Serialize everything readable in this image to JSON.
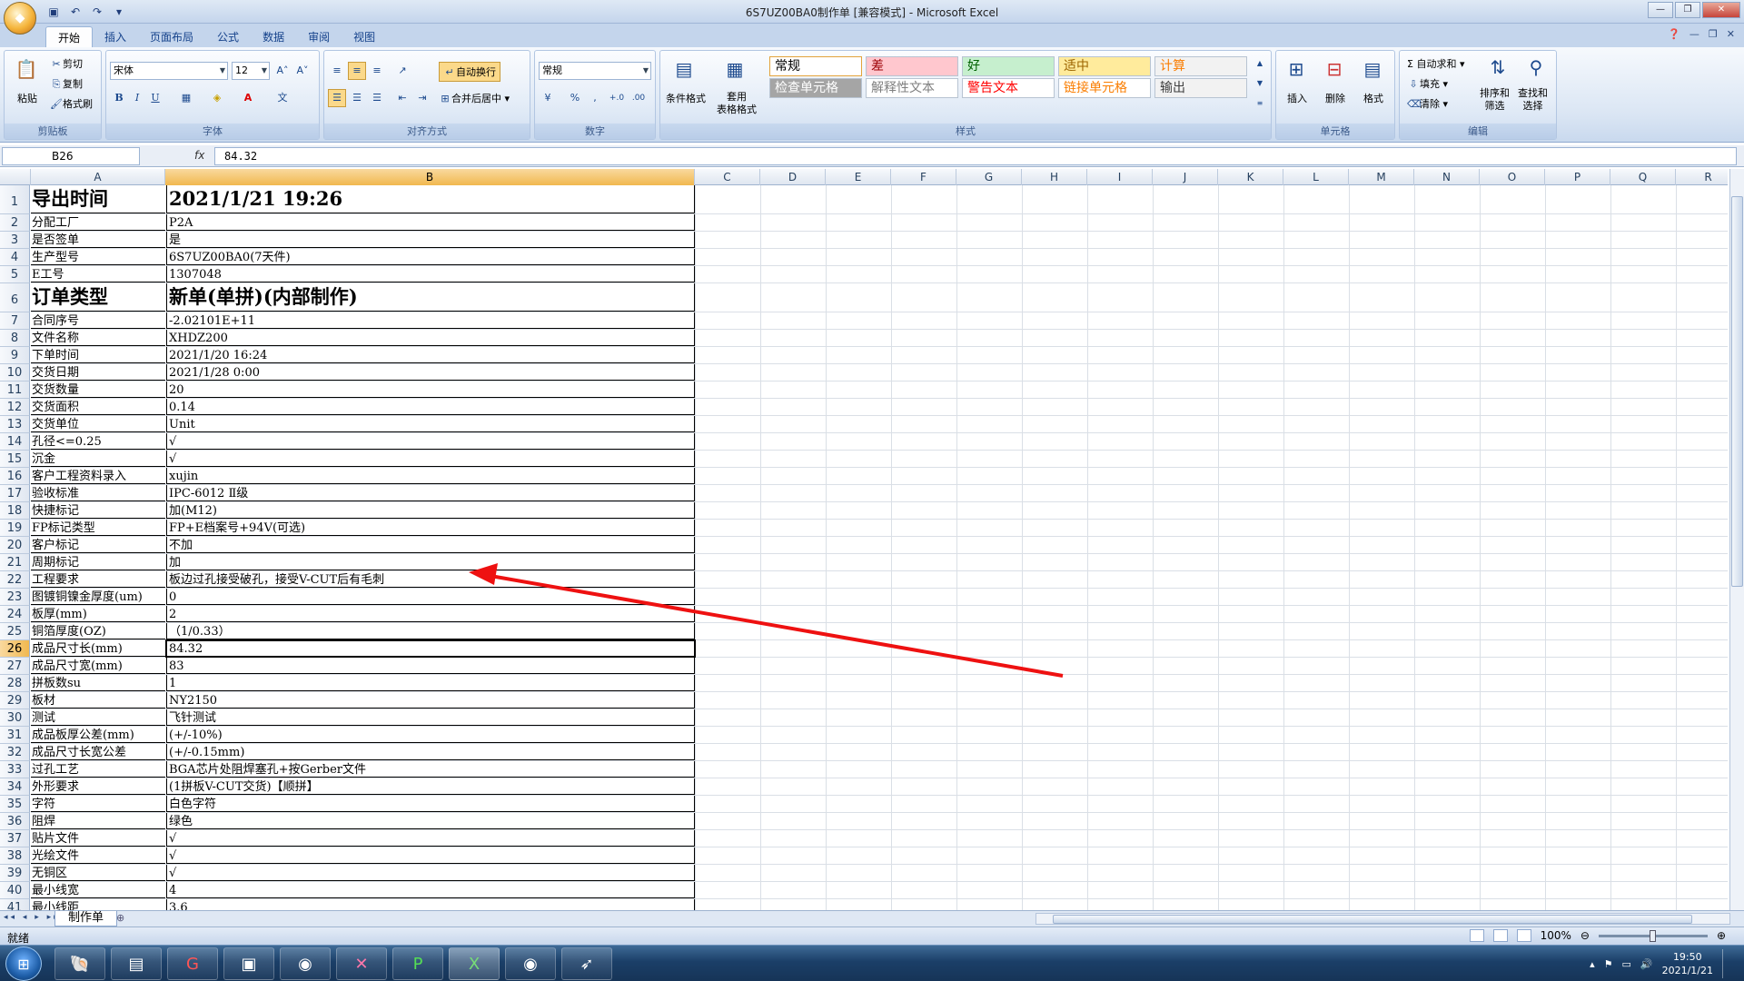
{
  "window": {
    "title": "6S7UZ00BA0制作单 [兼容模式] - Microsoft Excel",
    "office_logo": "office-logo"
  },
  "qat": [
    "save-icon",
    "undo-icon",
    "redo-icon",
    "customize-icon"
  ],
  "tabs": [
    "开始",
    "插入",
    "页面布局",
    "公式",
    "数据",
    "审阅",
    "视图"
  ],
  "ribbon": {
    "clipboard": {
      "label": "剪贴板",
      "paste": "粘贴",
      "cut": "剪切",
      "copy": "复制",
      "format_painter": "格式刷"
    },
    "font": {
      "label": "字体",
      "name": "宋体",
      "size": "12",
      "bold": "B",
      "italic": "I",
      "underline": "U",
      "grow": "A˄",
      "shrink": "A˅",
      "font_color_glyph": "A"
    },
    "alignment": {
      "label": "对齐方式",
      "wrap": "自动换行",
      "merge": "合并后居中"
    },
    "number": {
      "label": "数字",
      "format": "常规",
      "percent": "%",
      "comma": ",",
      "inc": "+.0",
      "dec": ".00"
    },
    "styles": {
      "label": "样式",
      "conditional": "条件格式",
      "table": "套用\n表格格式",
      "cells": [
        {
          "text": "常规",
          "color": "#000000",
          "bg": "#ffffff"
        },
        {
          "text": "差",
          "color": "#9c0006",
          "bg": "#ffc7ce"
        },
        {
          "text": "好",
          "color": "#006100",
          "bg": "#c6efce"
        },
        {
          "text": "适中",
          "color": "#9c6500",
          "bg": "#ffeb9c"
        },
        {
          "text": "计算",
          "color": "#fa7d00",
          "bg": "#f2f2f2"
        },
        {
          "text": "检查单元格",
          "color": "#ffffff",
          "bg": "#a5a5a5"
        },
        {
          "text": "解释性文本",
          "color": "#7f7f7f",
          "bg": "#ffffff"
        },
        {
          "text": "警告文本",
          "color": "#ff0000",
          "bg": "#ffffff"
        },
        {
          "text": "链接单元格",
          "color": "#fa7d00",
          "bg": "#ffffff"
        },
        {
          "text": "输出",
          "color": "#3f3f3f",
          "bg": "#f2f2f2"
        }
      ]
    },
    "cells": {
      "label": "单元格",
      "insert": "插入",
      "delete": "删除",
      "format": "格式"
    },
    "editing": {
      "label": "编辑",
      "autosum": "Σ 自动求和",
      "fill": "填充",
      "clear": "清除",
      "sort": "排序和\n筛选",
      "find": "查找和\n选择"
    }
  },
  "formula_bar": {
    "name_box": "B26",
    "fx": "fx",
    "content": "84.32"
  },
  "columns": [
    "A",
    "B",
    "C",
    "D",
    "E",
    "F",
    "G",
    "H",
    "I",
    "J",
    "K",
    "L",
    "M",
    "N",
    "O",
    "P",
    "Q",
    "R"
  ],
  "rows": [
    {
      "n": "1",
      "a": "导出时间",
      "b": "2021/1/21  19:26",
      "big": true
    },
    {
      "n": "2",
      "a": "分配工厂",
      "b": "P2A"
    },
    {
      "n": "3",
      "a": "是否签单",
      "b": "是"
    },
    {
      "n": "4",
      "a": "生产型号",
      "b": "6S7UZ00BA0(7天件)"
    },
    {
      "n": "5",
      "a": "E工号",
      "b": "1307048"
    },
    {
      "n": "6",
      "a": "订单类型",
      "b": "新单(单拼)(内部制作)",
      "big": true
    },
    {
      "n": "7",
      "a": "合同序号",
      "b": "-2.02101E+11"
    },
    {
      "n": "8",
      "a": "文件名称",
      "b": "XHDZ200"
    },
    {
      "n": "9",
      "a": "下单时间",
      "b": "2021/1/20 16:24"
    },
    {
      "n": "10",
      "a": "交货日期",
      "b": "2021/1/28 0:00"
    },
    {
      "n": "11",
      "a": "交货数量",
      "b": "20"
    },
    {
      "n": "12",
      "a": "交货面积",
      "b": "0.14"
    },
    {
      "n": "13",
      "a": "交货单位",
      "b": "Unit"
    },
    {
      "n": "14",
      "a": "孔径<=0.25",
      "b": "√"
    },
    {
      "n": "15",
      "a": "沉金",
      "b": "√"
    },
    {
      "n": "16",
      "a": "客户工程资料录入",
      "b": "xujin"
    },
    {
      "n": "17",
      "a": "验收标准",
      "b": "IPC-6012 Ⅱ级"
    },
    {
      "n": "18",
      "a": "快捷标记",
      "b": "加(M12)"
    },
    {
      "n": "19",
      "a": "FP标记类型",
      "b": "FP+E档案号+94V(可选)"
    },
    {
      "n": "20",
      "a": "客户标记",
      "b": "不加"
    },
    {
      "n": "21",
      "a": "周期标记",
      "b": "加"
    },
    {
      "n": "22",
      "a": "工程要求",
      "b": "板边过孔接受破孔，接受V-CUT后有毛刺"
    },
    {
      "n": "23",
      "a": "图镀铜镍金厚度(um)",
      "b": "0"
    },
    {
      "n": "24",
      "a": "板厚(mm)",
      "b": "2"
    },
    {
      "n": "25",
      "a": "铜箔厚度(OZ)",
      "b": "（1/0.33）"
    },
    {
      "n": "26",
      "a": "成品尺寸长(mm)",
      "b": "84.32",
      "active": true
    },
    {
      "n": "27",
      "a": "成品尺寸宽(mm)",
      "b": "83"
    },
    {
      "n": "28",
      "a": "拼板数su",
      "b": "1"
    },
    {
      "n": "29",
      "a": "板材",
      "b": "NY2150"
    },
    {
      "n": "30",
      "a": "测试",
      "b": "飞针测试"
    },
    {
      "n": "31",
      "a": "成品板厚公差(mm)",
      "b": "(+/-10%)"
    },
    {
      "n": "32",
      "a": "成品尺寸长宽公差",
      "b": "(+/-0.15mm)"
    },
    {
      "n": "33",
      "a": "过孔工艺",
      "b": "BGA芯片处阻焊塞孔+按Gerber文件"
    },
    {
      "n": "34",
      "a": "外形要求",
      "b": "(1拼板V-CUT交货)【顺拼】"
    },
    {
      "n": "35",
      "a": "字符",
      "b": "白色字符"
    },
    {
      "n": "36",
      "a": "阻焊",
      "b": "绿色"
    },
    {
      "n": "37",
      "a": "贴片文件",
      "b": "√"
    },
    {
      "n": "38",
      "a": "光绘文件",
      "b": "√"
    },
    {
      "n": "39",
      "a": "无铜区",
      "b": "√"
    },
    {
      "n": "40",
      "a": "最小线宽",
      "b": "4"
    },
    {
      "n": "41",
      "a": "最小线距",
      "b": "3.6"
    }
  ],
  "sheet": {
    "tab": "制作单",
    "nav": "◂◂ ◂ ▸ ▸▸"
  },
  "status": {
    "ready": "就绪",
    "zoom": "100%"
  },
  "taskbar": {
    "start": "start-orb",
    "apps": [
      "shell-icon",
      "notepad-icon",
      "app-g-icon",
      "save-disk-icon",
      "eye-icon",
      "x-app-icon",
      "p-app-icon",
      "excel-icon",
      "eye2-icon",
      "feather-icon"
    ],
    "time": "19:50",
    "date": "2021/1/21"
  },
  "annotation": {
    "color": "#ee1111"
  }
}
